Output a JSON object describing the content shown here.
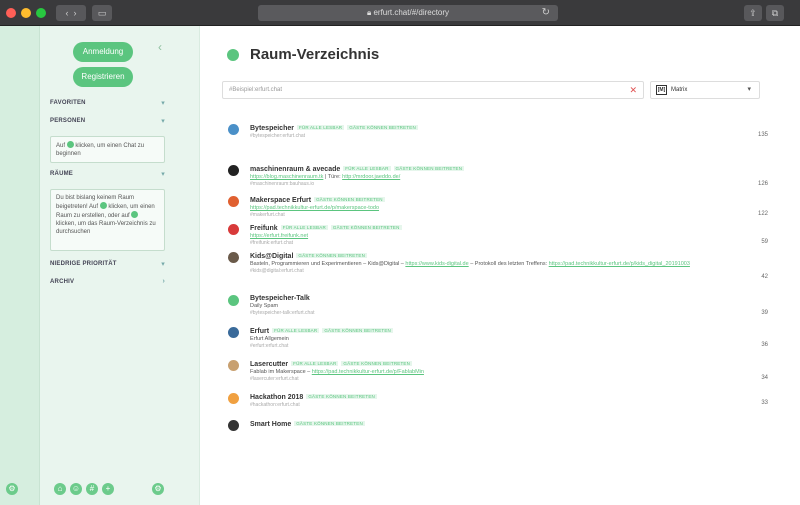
{
  "browser": {
    "url": "erfurt.chat/#/directory",
    "colors": {
      "close": "#ff5f57",
      "minimize": "#febc2e",
      "zoom": "#28c840"
    }
  },
  "sidebar": {
    "login_label": "Anmeldung",
    "register_label": "Registrieren",
    "sections": {
      "favorites": "FAVORITEN",
      "people": "PERSONEN",
      "rooms": "RÄUME",
      "low_priority": "NIEDRIGE PRIORITÄT",
      "archive": "ARCHIV"
    },
    "people_hint_before": "Auf",
    "people_hint_after": "klicken, um einen Chat zu beginnen",
    "rooms_hint_before": "Du bist bislang keinem Raum beigetreten! Auf",
    "rooms_hint_middle": "klicken, um einen Raum zu erstellen, oder auf",
    "rooms_hint_after": "klicken, um das Raum-Verzeichnis zu durchsuchen"
  },
  "main": {
    "title": "Raum-Verzeichnis",
    "search_placeholder": "#Beispiel:erfurt.chat",
    "protocol_badge": "[M]",
    "protocol_name": "Matrix",
    "rooms": [
      {
        "name": "Bytespeicher",
        "tags": [
          "FÜR ALLE LESBAR",
          "GÄSTE KÖNNEN BEITRETEN"
        ],
        "topic": [],
        "alias": "#bytespeicher:erfurt.chat",
        "count": "135",
        "avatar_color": "#4a90c8"
      },
      {
        "name": "maschinenraum & avecade",
        "tags": [
          "FÜR ALLE LESBAR",
          "GÄSTE KÖNNEN BEITRETEN"
        ],
        "topic": [
          {
            "text": "https://blog.maschinenraum.tk",
            "link": true
          },
          {
            "text": " | Türe: ",
            "link": false
          },
          {
            "text": "http://mrdoor.jaeddo.de/",
            "link": true
          }
        ],
        "alias": "#maschinenraum:bauhaus.io",
        "count": "126",
        "avatar_color": "#222222"
      },
      {
        "name": "Makerspace Erfurt",
        "tags": [
          "GÄSTE KÖNNEN BEITRETEN"
        ],
        "topic": [
          {
            "text": "https://pad.technikkultur-erfurt.de/p/makerspace-todo",
            "link": true
          }
        ],
        "alias": "#makerfurt.chat",
        "count": "122",
        "avatar_color": "#e06030"
      },
      {
        "name": "Freifunk",
        "tags": [
          "FÜR ALLE LESBAR",
          "GÄSTE KÖNNEN BEITRETEN"
        ],
        "topic": [
          {
            "text": "https://erfurt.freifunk.net",
            "link": true
          }
        ],
        "alias": "#freifunk:erfurt.chat",
        "count": "59",
        "avatar_color": "#d83a3a"
      },
      {
        "name": "Kids@Digital",
        "tags": [
          "GÄSTE KÖNNEN BEITRETEN"
        ],
        "topic": [
          {
            "text": "Basteln, Programmieren und Experimentieren – Kids@Digital – ",
            "link": false
          },
          {
            "text": "https://www.kids-digital.de",
            "link": true
          },
          {
            "text": " – Protokoll des letzten Treffens: ",
            "link": false
          },
          {
            "text": "https://pad.technikkultur-erfurt.de/p/kids_digital_20191003",
            "link": true
          }
        ],
        "alias": "#kids@digital:erfurt.chat",
        "count": "42",
        "avatar_color": "#6a5a4a"
      },
      {
        "name": "Bytespeicher-Talk",
        "tags": [],
        "topic": [
          {
            "text": "Daily Spam",
            "link": false
          }
        ],
        "alias": "#bytespeicher-talk:erfurt.chat",
        "count": "39",
        "avatar_color": "#5bc57f"
      },
      {
        "name": "Erfurt",
        "tags": [
          "FÜR ALLE LESBAR",
          "GÄSTE KÖNNEN BEITRETEN"
        ],
        "topic": [
          {
            "text": "Erfurt Allgemein",
            "link": false
          }
        ],
        "alias": "#erfurt:erfurt.chat",
        "count": "36",
        "avatar_color": "#3a6a9a"
      },
      {
        "name": "Lasercutter",
        "tags": [
          "FÜR ALLE LESBAR",
          "GÄSTE KÖNNEN BEITRETEN"
        ],
        "topic": [
          {
            "text": "Fablab im Makerspace – ",
            "link": false
          },
          {
            "text": "https://pad.technikkultur-erfurt.de/p/FablabMin",
            "link": true
          }
        ],
        "alias": "#lasercuter:erfurt.chat",
        "count": "34",
        "avatar_color": "#c8a070"
      },
      {
        "name": "Hackathon 2018",
        "tags": [
          "GÄSTE KÖNNEN BEITRETEN"
        ],
        "topic": [],
        "alias": "#hackathon:erfurt.chat",
        "count": "33",
        "avatar_color": "#f0a040"
      },
      {
        "name": "Smart Home",
        "tags": [
          "GÄSTE KÖNNEN BEITRETEN"
        ],
        "topic": [],
        "alias": "",
        "count": "",
        "avatar_color": "#333333"
      }
    ]
  }
}
